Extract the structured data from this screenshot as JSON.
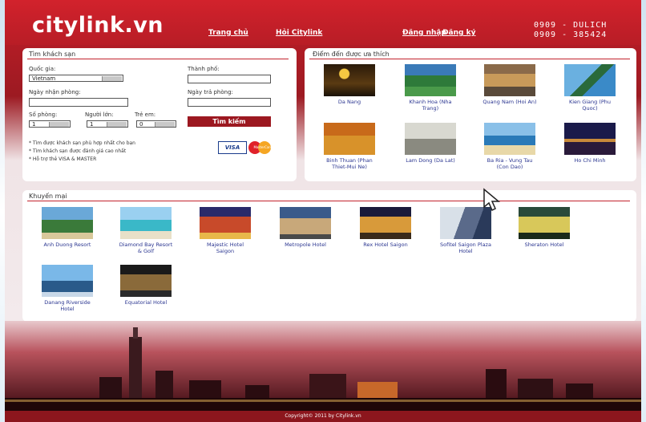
{
  "header": {
    "logo": "citylink.vn",
    "nav": [
      "Trang chủ",
      "Hỏi Citylink"
    ],
    "auth": [
      "Đăng nhập",
      "Đăng ký"
    ],
    "hotline_1": "0909 - DULICH",
    "hotline_2": "0909 - 385424"
  },
  "search": {
    "title": "Tìm khách sạn",
    "country_label": "Quốc gia:",
    "country_value": "Vietnam",
    "city_label": "Thành phố:",
    "checkin_label": "Ngày nhận phòng:",
    "checkout_label": "Ngày trả phòng:",
    "rooms_label": "Số phòng:",
    "adults_label": "Người lớn:",
    "children_label": "Trẻ em:",
    "rooms_value": "1",
    "adults_value": "1",
    "children_value": "0",
    "button": "Tìm kiếm",
    "notes": [
      "* Tìm được khách sạn phù hợp nhất cho bạn",
      "* Tìm khách sạn được đánh giá cao nhất",
      "* Hỗ trợ thẻ VISA & MASTER"
    ],
    "visa": "VISA",
    "mastercard": "MasterCard"
  },
  "destinations": {
    "title": "Điểm đến được ưa thích",
    "items": [
      {
        "name": "Da Nang"
      },
      {
        "name": "Khanh Hoa (Nha Trang)"
      },
      {
        "name": "Quang Nam (Hoi An)"
      },
      {
        "name": "Kien Giang (Phu Quoc)"
      },
      {
        "name": "Binh Thuan (Phan Thiet-Mui Ne)"
      },
      {
        "name": "Lam Dong (Da Lat)"
      },
      {
        "name": "Ba Ria - Vung Tau (Con Dao)"
      },
      {
        "name": "Ho Chi Minh"
      }
    ]
  },
  "promotions": {
    "title": "Khuyến mại",
    "items": [
      {
        "name": "Anh Duong Resort"
      },
      {
        "name": "Diamond Bay Resort & Golf"
      },
      {
        "name": "Majestic Hotel Saigon"
      },
      {
        "name": "Metropole Hotel"
      },
      {
        "name": "Rex Hotel Saigon"
      },
      {
        "name": "Sofitel Saigon Plaza Hotel"
      },
      {
        "name": "Sheraton Hotel"
      },
      {
        "name": "Danang Riverside Hotel"
      },
      {
        "name": "Equatorial Hotel"
      }
    ]
  },
  "footer": {
    "copyright": "Copyright© 2011 by Citylink.vn"
  },
  "colors": {
    "brand": "#c8202a",
    "link": "#2a3590"
  }
}
